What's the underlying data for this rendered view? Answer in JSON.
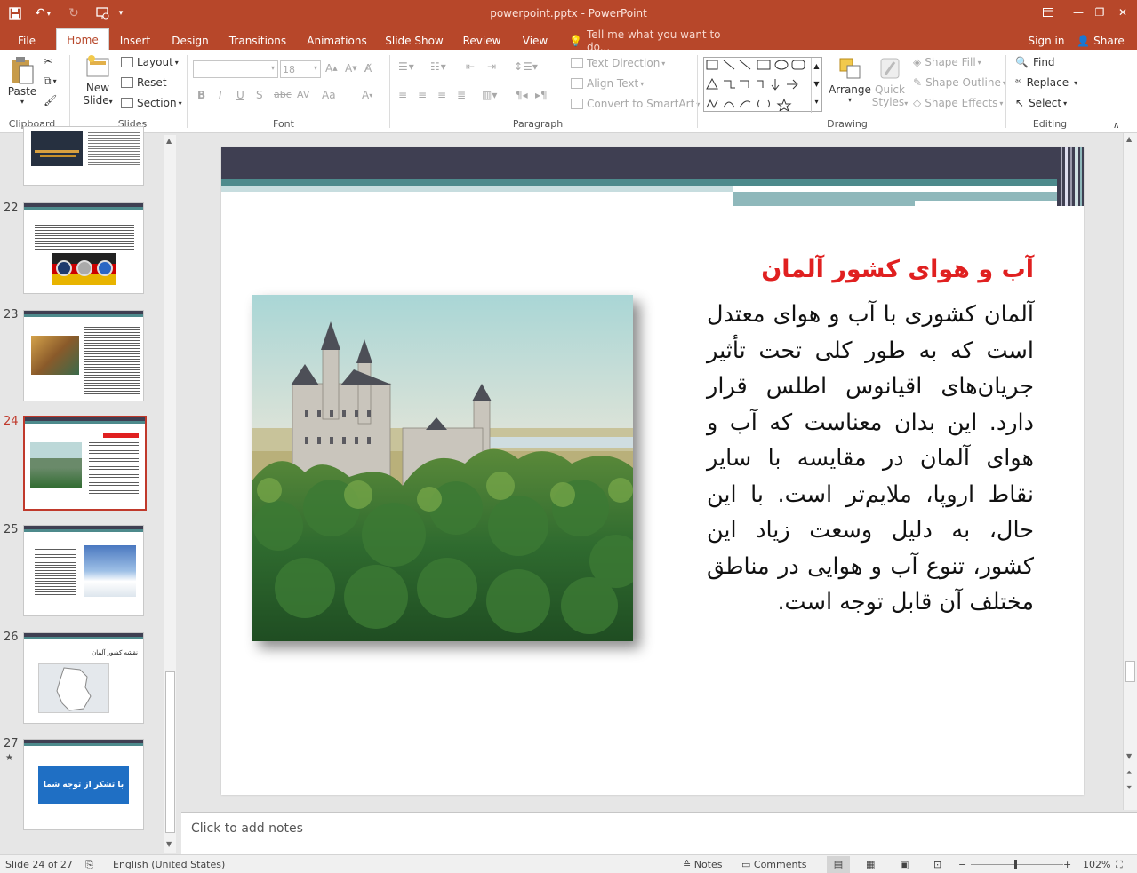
{
  "titlebar": {
    "title": "powerpoint.pptx - PowerPoint",
    "save_icon": "save-icon",
    "undo_icon": "undo-icon",
    "redo_icon": "redo-icon",
    "present_icon": "present-from-start-icon"
  },
  "tabs": [
    "File",
    "Home",
    "Insert",
    "Design",
    "Transitions",
    "Animations",
    "Slide Show",
    "Review",
    "View"
  ],
  "tell_me": "Tell me what you want to do...",
  "sign_in": "Sign in",
  "share": "Share",
  "ribbon": {
    "clipboard": {
      "label": "Clipboard",
      "paste": "Paste"
    },
    "slides": {
      "label": "Slides",
      "new_slide": "New",
      "new_slide2": "Slide",
      "layout": "Layout",
      "reset": "Reset",
      "section": "Section"
    },
    "font": {
      "label": "Font",
      "font_name": "",
      "font_size": "18",
      "bold": "B",
      "italic": "I",
      "underline": "U",
      "shadow": "S",
      "strike": "abc",
      "spacing": "AV",
      "case": "Aa"
    },
    "paragraph": {
      "label": "Paragraph",
      "text_direction": "Text Direction",
      "align_text": "Align Text",
      "convert_smartart": "Convert to SmartArt"
    },
    "drawing": {
      "label": "Drawing",
      "arrange": "Arrange",
      "quick_styles": "Quick",
      "quick_styles2": "Styles",
      "shape_fill": "Shape Fill",
      "shape_outline": "Shape Outline",
      "shape_effects": "Shape Effects"
    },
    "editing": {
      "label": "Editing",
      "find": "Find",
      "replace": "Replace",
      "select": "Select"
    }
  },
  "thumbnails": [
    {
      "num": "22"
    },
    {
      "num": "23"
    },
    {
      "num": "24"
    },
    {
      "num": "25"
    },
    {
      "num": "26"
    },
    {
      "num": "27"
    }
  ],
  "thumb_texts": {
    "t26_title": "نقشه کشور آلمان",
    "t27_button": "با تشکر از توجه شما"
  },
  "slide": {
    "title": "آب و هوای کشور آلمان",
    "body": "آلمان کشوری با آب و هوای معتدل است که به طور کلی تحت تأثیر جریان‌های اقیانوس اطلس قرار دارد. این بدان معناست که آب و هوای آلمان در مقایسه با سایر نقاط اروپا، ملایم‌تر است. با این حال، به دلیل وسعت زیاد این کشور، تنوع آب و هوایی در مناطق مختلف آن قابل توجه است.",
    "photo": "neuschwanstein-castle-photo"
  },
  "notes_placeholder": "Click to add notes",
  "status": {
    "slide_counter": "Slide 24 of 27",
    "language": "English (United States)",
    "notes": "Notes",
    "comments": "Comments",
    "zoom": "102%"
  },
  "colors": {
    "accent": "#b7472a",
    "title_red": "#e02020",
    "slide_dark": "#3f3f52",
    "slide_teal": "#4d8a8c"
  }
}
